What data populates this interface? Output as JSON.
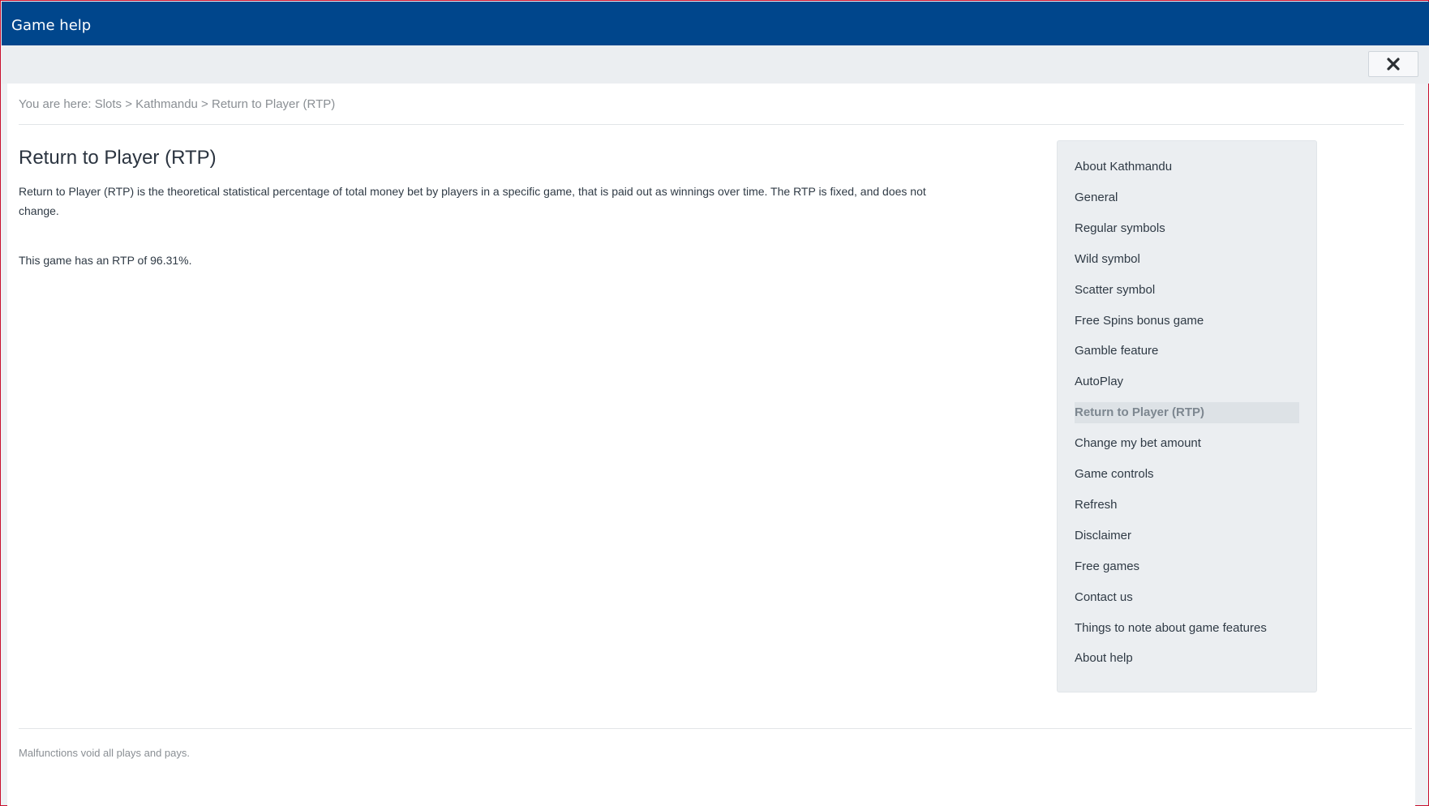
{
  "window": {
    "title": "Game help"
  },
  "toolbar": {
    "close_icon": "close-icon"
  },
  "breadcrumb": {
    "prefix": "You are here: ",
    "items": [
      "Slots",
      "Kathmandu",
      "Return to Player (RTP)"
    ],
    "separator": " > "
  },
  "main": {
    "title": "Return to Player (RTP)",
    "paragraph1": "Return to Player (RTP) is the theoretical statistical percentage of total money bet by players in a specific game, that is paid out as winnings over time. The RTP is fixed, and does not change.",
    "paragraph2": "This game has an RTP of 96.31%."
  },
  "nav": {
    "items": [
      {
        "label": "About Kathmandu"
      },
      {
        "label": "General"
      },
      {
        "label": "Regular symbols"
      },
      {
        "label": "Wild symbol"
      },
      {
        "label": "Scatter symbol"
      },
      {
        "label": "Free Spins bonus game"
      },
      {
        "label": "Gamble feature"
      },
      {
        "label": "AutoPlay"
      },
      {
        "label": "Return to Player (RTP)"
      },
      {
        "label": "Change my bet amount"
      },
      {
        "label": "Game controls"
      },
      {
        "label": "Refresh"
      },
      {
        "label": "Disclaimer"
      },
      {
        "label": "Free games"
      },
      {
        "label": "Contact us"
      },
      {
        "label": "Things to note about game features"
      },
      {
        "label": "About help"
      }
    ],
    "active_index": 8
  },
  "footer": {
    "note": "Malfunctions void all plays and pays."
  },
  "colors": {
    "titlebar": "#00468c",
    "frame_border": "#c8102e",
    "nav_background": "#ebeef1",
    "text": "#2f3a45",
    "muted": "#8a8f94"
  }
}
